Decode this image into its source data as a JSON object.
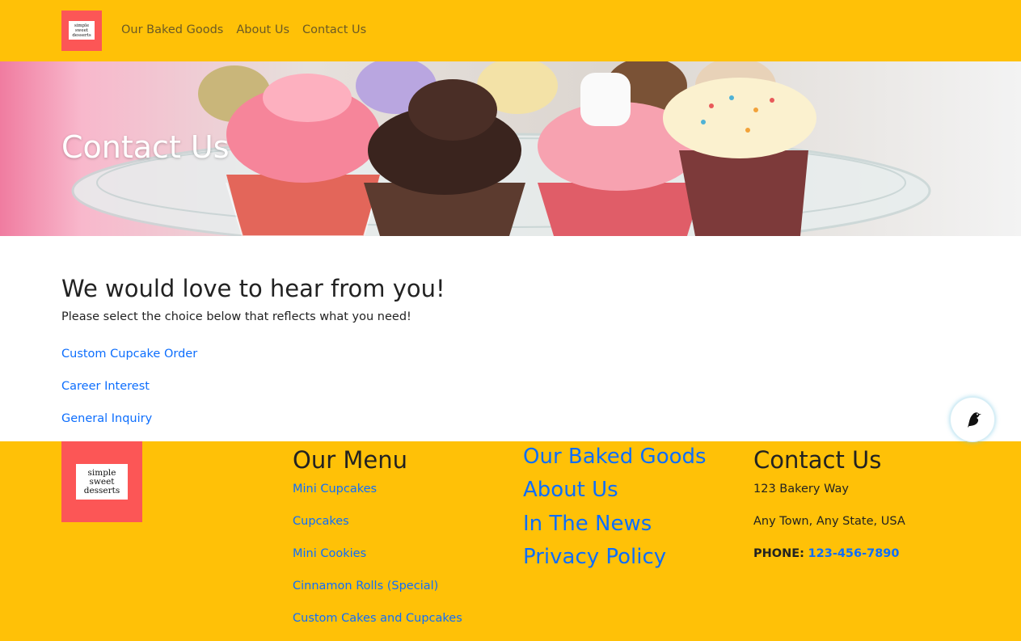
{
  "nav": {
    "logo_lines": [
      "simple",
      "sweet",
      "desserts"
    ],
    "links": [
      "Our Baked Goods",
      "About Us",
      "Contact Us"
    ]
  },
  "hero": {
    "title": "Contact Us"
  },
  "main": {
    "heading": "We would love to hear from you!",
    "subtext": "Please select the choice below that reflects what you need!",
    "choices": [
      "Custom Cupcake Order",
      "Career Interest",
      "General Inquiry"
    ]
  },
  "footer": {
    "logo_lines": [
      "simple",
      "sweet",
      "desserts"
    ],
    "menu": {
      "title": "Our Menu",
      "items": [
        "Mini Cupcakes",
        "Cupcakes",
        "Mini Cookies",
        "Cinnamon Rolls (Special)",
        "Custom Cakes and Cupcakes"
      ]
    },
    "links": [
      "Our Baked Goods",
      "About Us",
      "In The News",
      "Privacy Policy"
    ],
    "contact": {
      "title": "Contact Us",
      "address1": "123 Bakery Way",
      "address2": "Any Town, Any State, USA",
      "phone_label": "PHONE:",
      "phone": "123-456-7890"
    }
  },
  "colors": {
    "yellow": "#ffc107",
    "logo_red": "#fc5656",
    "link_blue": "#0d6efd"
  },
  "icons": {
    "chat_bot": "bird-icon"
  }
}
